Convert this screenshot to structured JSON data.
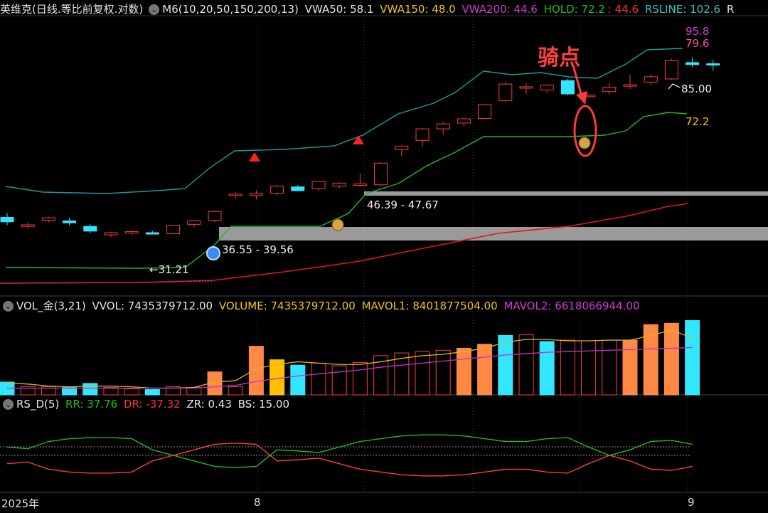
{
  "header": {
    "stock_title": "英维克(日线.等比前复权.对数)",
    "m6": "M6(10,20,50,150,200,13)",
    "vwa50": "VWA50: 58.1",
    "vwa150": "VWA150: 48.0",
    "vwa200": "VWA200: 44.6",
    "hold": "HOLD: 72.2",
    "hold2": ": 44.6",
    "rsline": "RSLINE: 102.6",
    "r": "R"
  },
  "volume_header": {
    "name": "VOL_金(3,21)",
    "vvol": "VVOL: 7435379712.00",
    "volume": "VOLUME: 7435379712.00",
    "mavol1": "MAVOL1: 8401877504.00",
    "mavol2": "MAVOL2: 6618066944.00"
  },
  "rs_header": {
    "name": "RS_D(5)",
    "rr": "RR: 37.76",
    "dr": "DR: -37.32",
    "zr": "ZR: 0.43",
    "bs": "BS: 15.00"
  },
  "annotations": {
    "ride_point": "骑点",
    "zone1": "36.55 - 39.56",
    "zone2": "46.39 - 47.67",
    "low_label": "←31.21",
    "high_label": "85.00",
    "rsline_val": "95.8",
    "vwa_val": "79.6",
    "hold_val": "72.2",
    "icon_money": "money-bag-icon",
    "icon_buy": "blue-orb-icon"
  },
  "x_axis": [
    "2025年",
    "8",
    "9"
  ],
  "colors": {
    "up": "#ff3b3b",
    "down": "#33e6ff",
    "hold_line": "#22b822",
    "rs_line": "#1a9a9a",
    "ma_line": "#e0151c",
    "vol_orange": "#ff8845",
    "vol_yellow": "#ffc000",
    "mavol1": "#d8b81c",
    "mavol2": "#c030d0"
  },
  "chart_data": {
    "type": "candlestick",
    "ohlc": [
      [
        39.2,
        40.1,
        37.6,
        38.3
      ],
      [
        37.4,
        38.2,
        36.9,
        37.7
      ],
      [
        38.6,
        39.3,
        38.2,
        39.1
      ],
      [
        38.5,
        39.0,
        37.6,
        38.1
      ],
      [
        37.4,
        37.8,
        36.1,
        36.5
      ],
      [
        35.8,
        36.4,
        35.4,
        36.2
      ],
      [
        36.2,
        36.6,
        35.8,
        36.4
      ],
      [
        36.2,
        36.5,
        35.9,
        36.1
      ],
      [
        36.0,
        37.7,
        35.9,
        37.6
      ],
      [
        37.8,
        38.6,
        37.2,
        38.5
      ],
      [
        38.6,
        40.6,
        38.2,
        40.4
      ],
      [
        44.1,
        44.6,
        43.2,
        44.2
      ],
      [
        43.9,
        45.1,
        43.0,
        44.4
      ],
      [
        44.4,
        46.4,
        43.9,
        46.1
      ],
      [
        45.9,
        46.3,
        44.9,
        45.0
      ],
      [
        45.5,
        47.3,
        45.0,
        47.2
      ],
      [
        46.1,
        47.1,
        45.6,
        46.8
      ],
      [
        46.6,
        49.3,
        45.9,
        46.6
      ],
      [
        46.4,
        52.2,
        46.1,
        51.9
      ],
      [
        55.7,
        56.9,
        53.8,
        56.7
      ],
      [
        58.4,
        62.2,
        56.7,
        62.0
      ],
      [
        62.0,
        64.3,
        60.3,
        63.6
      ],
      [
        63.9,
        65.7,
        62.7,
        65.3
      ],
      [
        65.4,
        70.6,
        65.2,
        70.3
      ],
      [
        71.8,
        78.8,
        71.3,
        78.2
      ],
      [
        76.6,
        78.4,
        74.2,
        77.1
      ],
      [
        75.8,
        78.2,
        74.8,
        77.8
      ],
      [
        79.6,
        80.3,
        73.8,
        74.3
      ],
      [
        73.5,
        74.1,
        72.9,
        73.8
      ],
      [
        75.2,
        78.8,
        74.1,
        76.9
      ],
      [
        77.6,
        82.1,
        76.2,
        77.9
      ],
      [
        79.0,
        82.3,
        77.9,
        81.2
      ],
      [
        80.3,
        89.1,
        79.8,
        88.3
      ],
      [
        87.4,
        89.9,
        85.3,
        86.5
      ],
      [
        86.9,
        88.5,
        83.8,
        86.4
      ]
    ],
    "volume_colors": [
      "down",
      "up",
      "up",
      "down",
      "down",
      "up",
      "up",
      "down",
      "up",
      "up",
      "orange",
      "up",
      "orange",
      "yellow",
      "down",
      "up",
      "up",
      "up",
      "up",
      "up",
      "up",
      "up",
      "orange",
      "orange",
      "down",
      "up",
      "down",
      "up",
      "up",
      "up",
      "orange",
      "orange",
      "orange",
      "down"
    ],
    "volume": [
      1.9,
      1.2,
      1.2,
      1.1,
      1.7,
      1.1,
      0.9,
      0.8,
      1.2,
      1.1,
      3.4,
      1.2,
      7.2,
      5.2,
      4.4,
      4.7,
      4.3,
      4.8,
      5.8,
      6.2,
      6.4,
      6.6,
      6.9,
      7.5,
      8.8,
      8.9,
      7.9,
      8.1,
      8.0,
      8.1,
      8.1,
      10.4,
      10.6,
      11.0
    ],
    "mavol1": [
      1.8,
      1.6,
      1.3,
      1.2,
      1.3,
      1.3,
      1.2,
      1.0,
      1.0,
      1.1,
      1.9,
      2.1,
      3.9,
      4.5,
      4.9,
      4.7,
      4.5,
      4.5,
      4.9,
      5.4,
      5.8,
      6.0,
      6.4,
      6.9,
      7.8,
      8.2,
      8.2,
      8.0,
      8.0,
      8.1,
      8.1,
      8.8,
      9.6,
      8.4
    ],
    "mavol2": [
      1.0,
      1.0,
      1.0,
      1.0,
      1.0,
      1.0,
      1.0,
      1.0,
      1.0,
      1.0,
      1.2,
      1.4,
      2.0,
      2.4,
      2.8,
      3.1,
      3.4,
      3.7,
      4.1,
      4.4,
      4.7,
      5.0,
      5.3,
      5.6,
      5.9,
      6.1,
      6.3,
      6.4,
      6.5,
      6.6,
      6.7,
      6.8,
      6.9,
      7.0
    ],
    "rr": [
      45,
      42,
      55,
      60,
      62,
      62,
      60,
      40,
      30,
      20,
      10,
      8,
      10,
      40,
      38,
      35,
      45,
      55,
      60,
      65,
      67,
      67,
      65,
      60,
      55,
      55,
      60,
      62,
      45,
      30,
      40,
      55,
      57,
      50
    ],
    "dr": [
      -45,
      -42,
      -55,
      -60,
      -62,
      -62,
      -60,
      -40,
      -30,
      -20,
      -10,
      -8,
      -10,
      -40,
      -38,
      -35,
      -45,
      -55,
      -60,
      -65,
      -67,
      -67,
      -65,
      -60,
      -55,
      -55,
      -60,
      -62,
      -45,
      -30,
      -40,
      -55,
      -57,
      -50
    ]
  }
}
